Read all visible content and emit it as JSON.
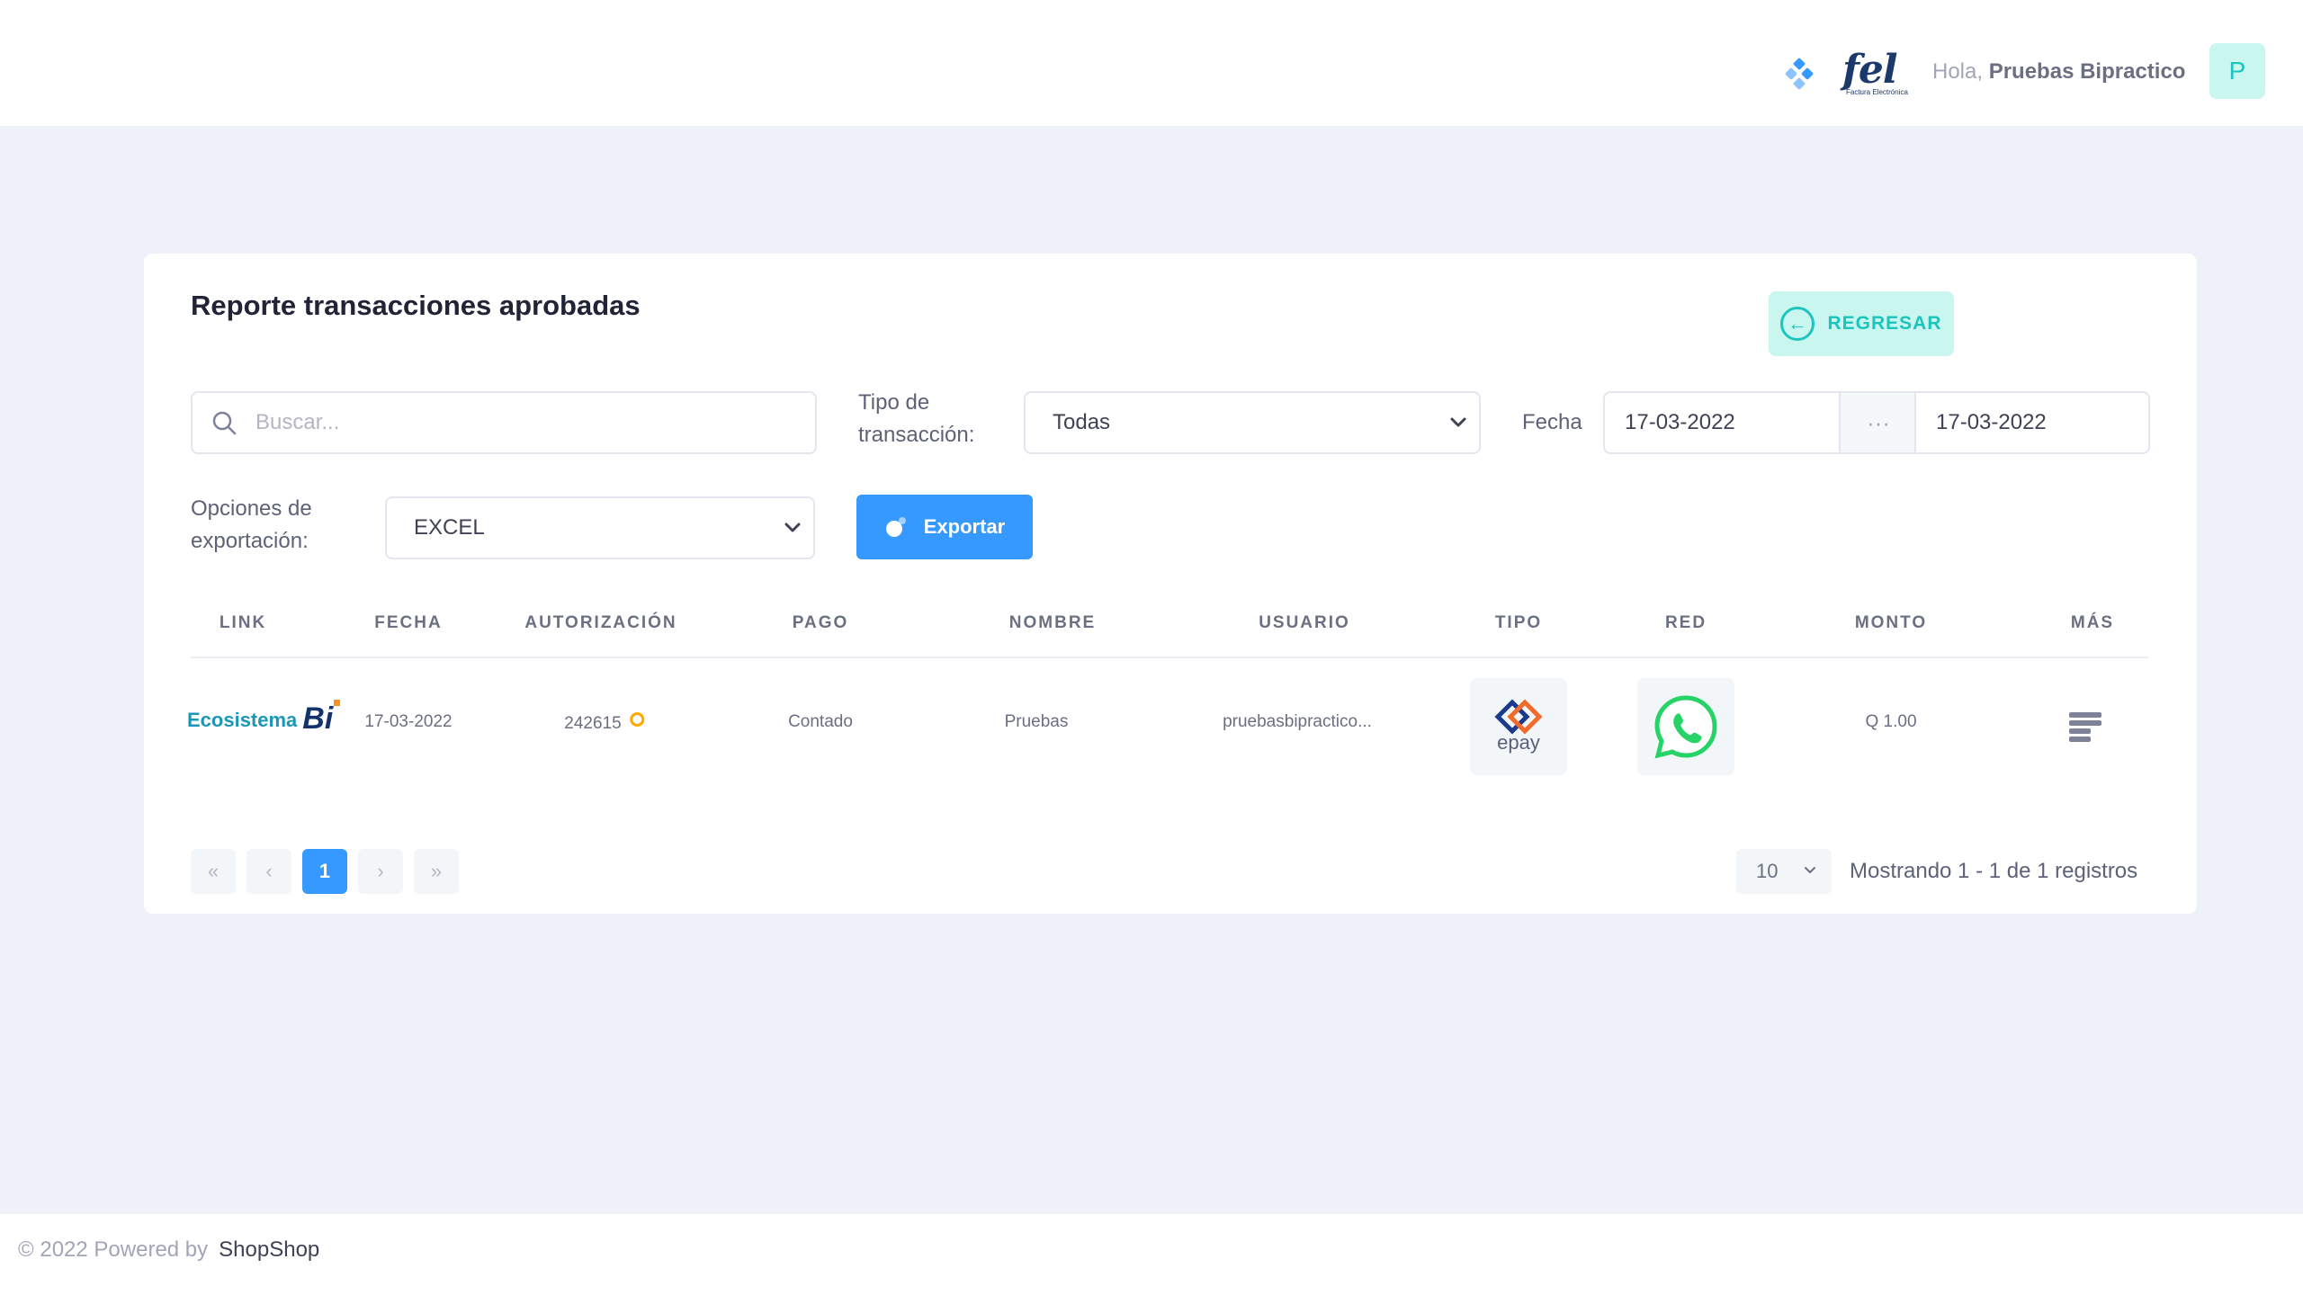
{
  "header": {
    "greeting": "Hola,",
    "user_name": "Pruebas Bipractico",
    "avatar_initial": "P",
    "logo_text": "fel",
    "logo_subtext": "Factura Electrónica"
  },
  "card": {
    "title": "Reporte transacciones aprobadas",
    "back_label": "REGRESAR"
  },
  "filters": {
    "search_placeholder": "Buscar...",
    "tipo_label": "Tipo de transacción:",
    "tipo_value": "Todas",
    "fecha_label": "Fecha",
    "date_from": "17-03-2022",
    "date_sep": "···",
    "date_to": "17-03-2022",
    "export_label": "Opciones de exportación:",
    "export_value": "EXCEL",
    "export_button": "Exportar"
  },
  "table": {
    "columns": [
      "LINK",
      "FECHA",
      "AUTORIZACIÓN",
      "PAGO",
      "NOMBRE",
      "USUARIO",
      "TIPO",
      "RED",
      "MONTO",
      "MÁS"
    ],
    "rows": [
      {
        "link_brand": "Ecosistema",
        "link_brand_mark": "Bi",
        "fecha": "17-03-2022",
        "autorizacion": "242615",
        "pago": "Contado",
        "nombre": "Pruebas",
        "usuario": "pruebasbipractico...",
        "tipo_logo": "epay",
        "red_icon": "whatsapp-icon",
        "monto": "Q 1.00"
      }
    ]
  },
  "pagination": {
    "first": "«",
    "prev": "‹",
    "current": "1",
    "next": "›",
    "last": "»",
    "per_page": "10",
    "showing": "Mostrando 1 - 1 de 1 registros"
  },
  "footer": {
    "copyright": "© 2022 Powered by",
    "brand": "ShopShop"
  },
  "colors": {
    "primary": "#3699ff",
    "success_light": "#c9f7f0",
    "success": "#1bc5bd",
    "warning": "#ffa800",
    "background": "#eff1f8"
  }
}
